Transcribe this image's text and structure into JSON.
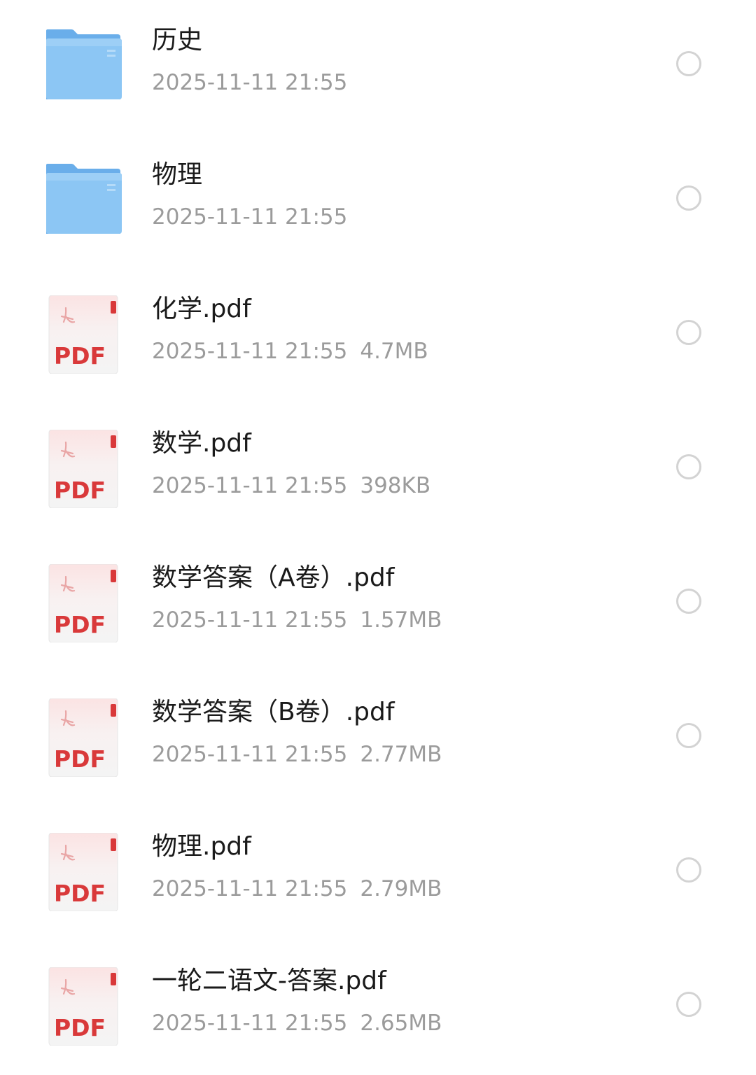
{
  "files": [
    {
      "name": "历史",
      "date": "2025-11-11 21:55",
      "size": "",
      "kind": "folder",
      "icon": "folder-icon"
    },
    {
      "name": "物理",
      "date": "2025-11-11 21:55",
      "size": "",
      "kind": "folder",
      "icon": "folder-icon"
    },
    {
      "name": "化学.pdf",
      "date": "2025-11-11 21:55",
      "size": "4.7MB",
      "kind": "pdf",
      "icon": "pdf-icon"
    },
    {
      "name": "数学.pdf",
      "date": "2025-11-11 21:55",
      "size": "398KB",
      "kind": "pdf",
      "icon": "pdf-icon"
    },
    {
      "name": "数学答案（A卷）.pdf",
      "date": "2025-11-11 21:55",
      "size": "1.57MB",
      "kind": "pdf",
      "icon": "pdf-icon"
    },
    {
      "name": "数学答案（B卷）.pdf",
      "date": "2025-11-11 21:55",
      "size": "2.77MB",
      "kind": "pdf",
      "icon": "pdf-icon"
    },
    {
      "name": "物理.pdf",
      "date": "2025-11-11 21:55",
      "size": "2.79MB",
      "kind": "pdf",
      "icon": "pdf-icon"
    },
    {
      "name": "一轮二语文-答案.pdf",
      "date": "2025-11-11 21:55",
      "size": "2.65MB",
      "kind": "pdf",
      "icon": "pdf-icon"
    }
  ],
  "pdf_icon_label": "PDF",
  "colors": {
    "folder": "#7fbdf2",
    "pdf_red": "#d9393a",
    "name_text": "#1a1a1a",
    "meta_text": "#9b9b9b",
    "radio_border": "#d3d3d3"
  }
}
